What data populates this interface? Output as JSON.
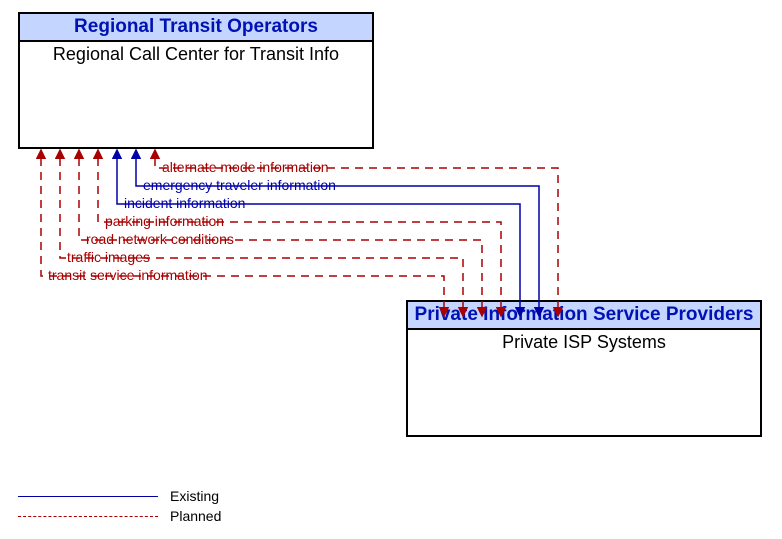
{
  "boxes": {
    "top": {
      "header": "Regional Transit Operators",
      "title": "Regional Call Center for Transit Info"
    },
    "bottom": {
      "header": "Private Information Service Providers",
      "title": "Private ISP Systems"
    }
  },
  "flows": [
    {
      "label": "alternate mode information",
      "style": "planned",
      "color": "#a80000"
    },
    {
      "label": "emergency traveler information",
      "style": "existing",
      "color": "#0000a8"
    },
    {
      "label": "incident information",
      "style": "existing",
      "color": "#0000a8"
    },
    {
      "label": "parking information",
      "style": "planned",
      "color": "#a80000"
    },
    {
      "label": "road network conditions",
      "style": "planned",
      "color": "#a80000"
    },
    {
      "label": "traffic images",
      "style": "planned",
      "color": "#a80000"
    },
    {
      "label": "transit service information",
      "style": "planned",
      "color": "#a80000"
    }
  ],
  "legend": {
    "existing": "Existing",
    "planned": "Planned"
  }
}
